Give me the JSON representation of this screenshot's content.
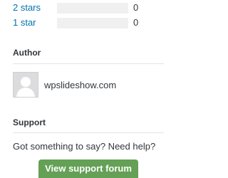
{
  "ratings": [
    {
      "label": "2 stars",
      "count": "0",
      "fraction": 0
    },
    {
      "label": "1 star",
      "count": "0",
      "fraction": 0
    }
  ],
  "author": {
    "heading": "Author",
    "name": "wpslideshow.com",
    "avatar_icon": "default-avatar-icon"
  },
  "support": {
    "heading": "Support",
    "text": "Got something to say? Need help?",
    "button_label": "View support forum"
  },
  "colors": {
    "link": "#0073aa",
    "button": "#64a055",
    "track": "#f0f0f1",
    "text": "#32373c"
  }
}
